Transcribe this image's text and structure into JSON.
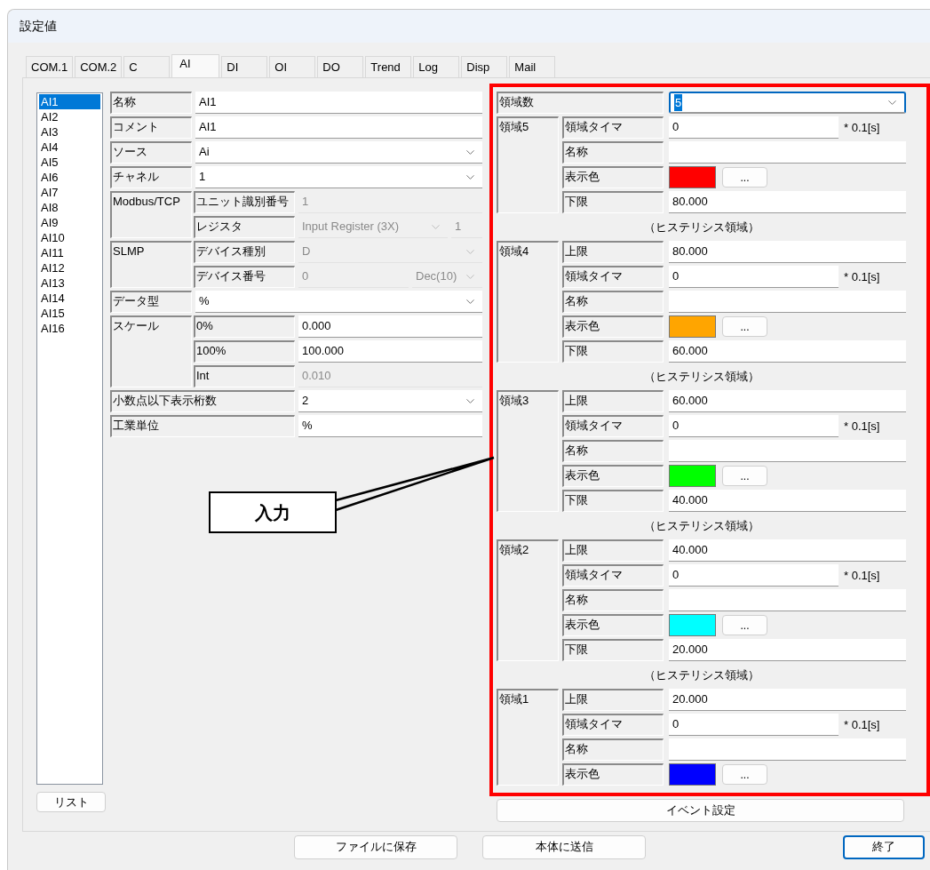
{
  "window": {
    "title": "設定値"
  },
  "tabs": [
    {
      "label": "COM.1",
      "selected": false
    },
    {
      "label": "COM.2",
      "selected": false
    },
    {
      "label": "C",
      "selected": false
    },
    {
      "label": "AI",
      "selected": true
    },
    {
      "label": "DI",
      "selected": false
    },
    {
      "label": "OI",
      "selected": false
    },
    {
      "label": "DO",
      "selected": false
    },
    {
      "label": "Trend",
      "selected": false
    },
    {
      "label": "Log",
      "selected": false
    },
    {
      "label": "Disp",
      "selected": false
    },
    {
      "label": "Mail",
      "selected": false
    }
  ],
  "channel_list": {
    "items": [
      {
        "label": "AI1",
        "selected": true
      },
      {
        "label": "AI2",
        "selected": false
      },
      {
        "label": "AI3",
        "selected": false
      },
      {
        "label": "AI4",
        "selected": false
      },
      {
        "label": "AI5",
        "selected": false
      },
      {
        "label": "AI6",
        "selected": false
      },
      {
        "label": "AI7",
        "selected": false
      },
      {
        "label": "AI8",
        "selected": false
      },
      {
        "label": "AI9",
        "selected": false
      },
      {
        "label": "AI10",
        "selected": false
      },
      {
        "label": "AI11",
        "selected": false
      },
      {
        "label": "AI12",
        "selected": false
      },
      {
        "label": "AI13",
        "selected": false
      },
      {
        "label": "AI14",
        "selected": false
      },
      {
        "label": "AI15",
        "selected": false
      },
      {
        "label": "AI16",
        "selected": false
      }
    ],
    "button": "リスト"
  },
  "form": [
    {
      "kind": "text",
      "label": "名称",
      "value": "AI1",
      "disabled": false
    },
    {
      "kind": "text",
      "label": "コメント",
      "value": "AI1",
      "disabled": false
    },
    {
      "kind": "select",
      "label": "ソース",
      "value": "Ai",
      "disabled": false
    },
    {
      "kind": "select",
      "label": "チャネル",
      "value": "1",
      "disabled": false
    },
    {
      "kind": "group",
      "label": "Modbus/TCP",
      "rows": [
        {
          "kind": "text",
          "label": "ユニット識別番号",
          "value": "1",
          "disabled": true
        },
        {
          "kind": "select_text",
          "label": "レジスタ",
          "value": "Input Register (3X)",
          "extra": "1",
          "disabled": true
        }
      ]
    },
    {
      "kind": "group",
      "label": "SLMP",
      "rows": [
        {
          "kind": "select",
          "label": "デバイス種別",
          "value": "D",
          "disabled": true
        },
        {
          "kind": "text_select",
          "label": "デバイス番号",
          "value": "0",
          "extra": "Dec(10)",
          "disabled": true
        }
      ]
    },
    {
      "kind": "select",
      "label": "データ型",
      "value": "%",
      "disabled": false
    },
    {
      "kind": "group",
      "label": "スケール",
      "rows": [
        {
          "kind": "text",
          "label": "0%",
          "value": "0.000",
          "disabled": false
        },
        {
          "kind": "text",
          "label": "100%",
          "value": "100.000",
          "disabled": false
        },
        {
          "kind": "text",
          "label": "Int",
          "value": "0.010",
          "disabled": true
        }
      ]
    },
    {
      "kind": "wide_select",
      "label": "小数点以下表示桁数",
      "value": "2",
      "disabled": false
    },
    {
      "kind": "wide_text",
      "label": "工業単位",
      "value": "%",
      "disabled": false
    }
  ],
  "regions": {
    "count": {
      "label": "領域数",
      "value": "5",
      "focused": true
    },
    "items": [
      {
        "kind": "zone",
        "label": "領域5",
        "rows": [
          {
            "kind": "timer",
            "label": "領域タイマ",
            "value": "0",
            "unit": "* 0.1[s]"
          },
          {
            "kind": "text",
            "label": "名称"
          },
          {
            "kind": "color",
            "label": "表示色",
            "color": "#ff0000",
            "button": "..."
          },
          {
            "kind": "text",
            "label": "下限",
            "value": "80.000"
          }
        ]
      },
      {
        "kind": "note",
        "text": "（ヒステリシス領域）"
      },
      {
        "kind": "zone",
        "label": "領域4",
        "rows": [
          {
            "kind": "text",
            "label": "上限",
            "value": "80.000"
          },
          {
            "kind": "timer",
            "label": "領域タイマ",
            "value": "0",
            "unit": "* 0.1[s]"
          },
          {
            "kind": "text",
            "label": "名称"
          },
          {
            "kind": "color",
            "label": "表示色",
            "color": "#ffa500",
            "button": "..."
          },
          {
            "kind": "text",
            "label": "下限",
            "value": "60.000"
          }
        ]
      },
      {
        "kind": "note",
        "text": "（ヒステリシス領域）"
      },
      {
        "kind": "zone",
        "label": "領域3",
        "rows": [
          {
            "kind": "text",
            "label": "上限",
            "value": "60.000"
          },
          {
            "kind": "timer",
            "label": "領域タイマ",
            "value": "0",
            "unit": "* 0.1[s]"
          },
          {
            "kind": "text",
            "label": "名称"
          },
          {
            "kind": "color",
            "label": "表示色",
            "color": "#00ff00",
            "button": "..."
          },
          {
            "kind": "text",
            "label": "下限",
            "value": "40.000"
          }
        ]
      },
      {
        "kind": "note",
        "text": "（ヒステリシス領域）"
      },
      {
        "kind": "zone",
        "label": "領域2",
        "rows": [
          {
            "kind": "text",
            "label": "上限",
            "value": "40.000"
          },
          {
            "kind": "timer",
            "label": "領域タイマ",
            "value": "0",
            "unit": "* 0.1[s]"
          },
          {
            "kind": "text",
            "label": "名称"
          },
          {
            "kind": "color",
            "label": "表示色",
            "color": "#00ffff",
            "button": "..."
          },
          {
            "kind": "text",
            "label": "下限",
            "value": "20.000"
          }
        ]
      },
      {
        "kind": "note",
        "text": "（ヒステリシス領域）"
      },
      {
        "kind": "zone",
        "label": "領域1",
        "rows": [
          {
            "kind": "text",
            "label": "上限",
            "value": "20.000"
          },
          {
            "kind": "timer",
            "label": "領域タイマ",
            "value": "0",
            "unit": "* 0.1[s]"
          },
          {
            "kind": "text",
            "label": "名称"
          },
          {
            "kind": "color",
            "label": "表示色",
            "color": "#0000ff",
            "button": "..."
          }
        ]
      }
    ],
    "event_button": "イベント設定"
  },
  "callout": {
    "text": "入力"
  },
  "buttons": [
    {
      "label": "ファイルに保存",
      "default": false
    },
    {
      "label": "本体に送信",
      "default": false
    },
    {
      "label": "終了",
      "default": true
    }
  ]
}
